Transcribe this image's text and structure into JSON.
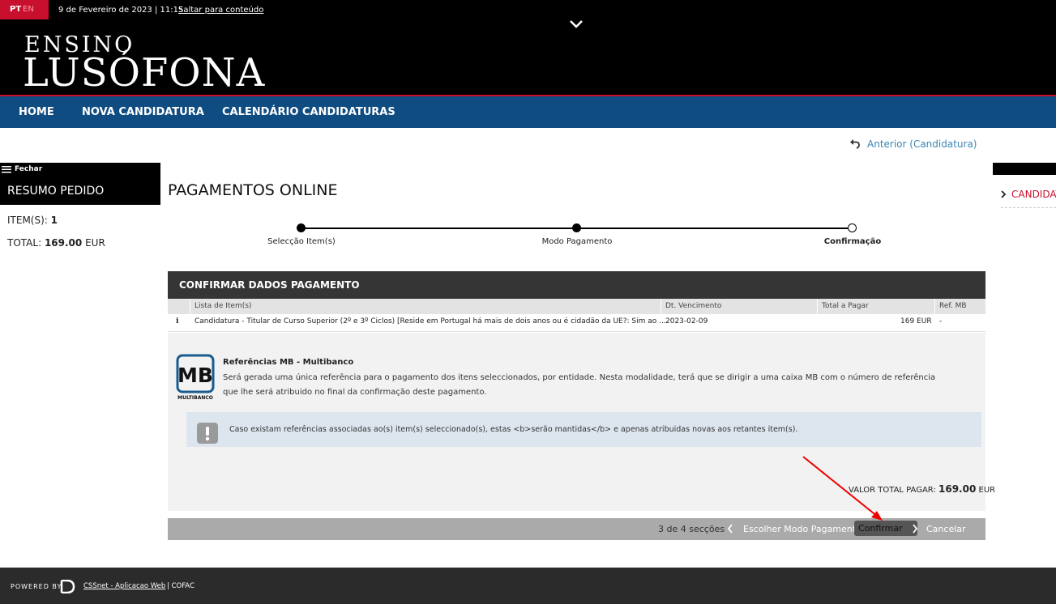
{
  "header": {
    "lang_pt": "PT",
    "lang_en": "EN",
    "datetime": "9 de Fevereiro de 2023 | 11:15",
    "skip_link": "Saltar para conteúdo",
    "logo_line1": "ENSINO",
    "logo_line2": "LUSÓFONA",
    "brand_color": "#c8102e"
  },
  "nav": {
    "items": [
      "HOME",
      "NOVA CANDIDATURA",
      "CALENDÁRIO CANDIDATURAS"
    ],
    "color": "#0f4c81"
  },
  "back_link": "Anterior (Candidatura)",
  "sidebar": {
    "close_label": "Fechar",
    "title": "RESUMO PEDIDO",
    "items_label": "ITEM(S):",
    "items_value": "1",
    "total_label": "TOTAL:",
    "total_value": "169.00",
    "total_currency": "EUR"
  },
  "right_sidebar": {
    "link": "CANDIDAT"
  },
  "main": {
    "title": "PAGAMENTOS ONLINE",
    "steps": [
      {
        "label": "Selecção Item(s)",
        "done": true
      },
      {
        "label": "Modo Pagamento",
        "done": true
      },
      {
        "label": "Confirmação",
        "done": false,
        "active": true
      }
    ],
    "panel_title": "CONFIRMAR DADOS PAGAMENTO",
    "table": {
      "headers": [
        "Lista de Item(s)",
        "Dt. Vencimento",
        "Total a Pagar",
        "Ref. MB"
      ],
      "rows": [
        {
          "icon": "i",
          "item": "Candidatura - Titular de Curso Superior (2º e 3º Ciclos) [Reside em Portugal há mais de dois anos ou é cidadão da UE?: Sim ao ...",
          "due": "2023-02-09",
          "total": "169 EUR",
          "ref": "-"
        }
      ]
    },
    "mb": {
      "logo_text": "MB",
      "logo_sub": "MULTIBANCO",
      "title": "Referências MB - Multibanco",
      "description": "Será gerada uma única referência para o pagamento dos itens seleccionados, por entidade. Nesta modalidade, terá que se dirigir a uma caixa MB com o número de referência que lhe será atribuido no final da confirmação deste pagamento."
    },
    "notice": "Caso existam referências associadas ao(s) item(s) seleccionado(s), estas <b>serão mantidas</b> e apenas atribuidas novas aos retantes item(s).",
    "total_label": "VALOR TOTAL PAGAR:",
    "total_value": "169.00",
    "total_currency": "EUR"
  },
  "actions": {
    "sections": "3 de 4 secções",
    "previous": "Escolher Modo Pagamento",
    "confirm": "Confirmar",
    "cancel": "Cancelar"
  },
  "footer": {
    "powered_by": "POWERED BY",
    "app_link": "CSSnet - Aplicacao Web",
    "org": "| COFAC"
  }
}
